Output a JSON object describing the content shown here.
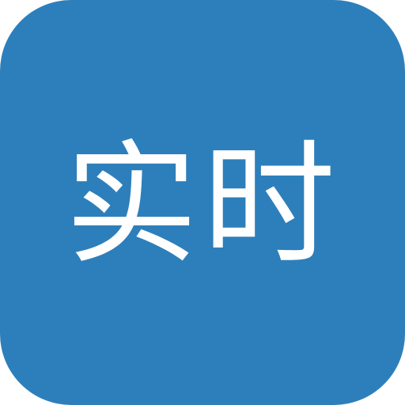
{
  "icon": {
    "label": "实时",
    "background_color": "#2d7fbb",
    "text_color": "#ffffff"
  }
}
